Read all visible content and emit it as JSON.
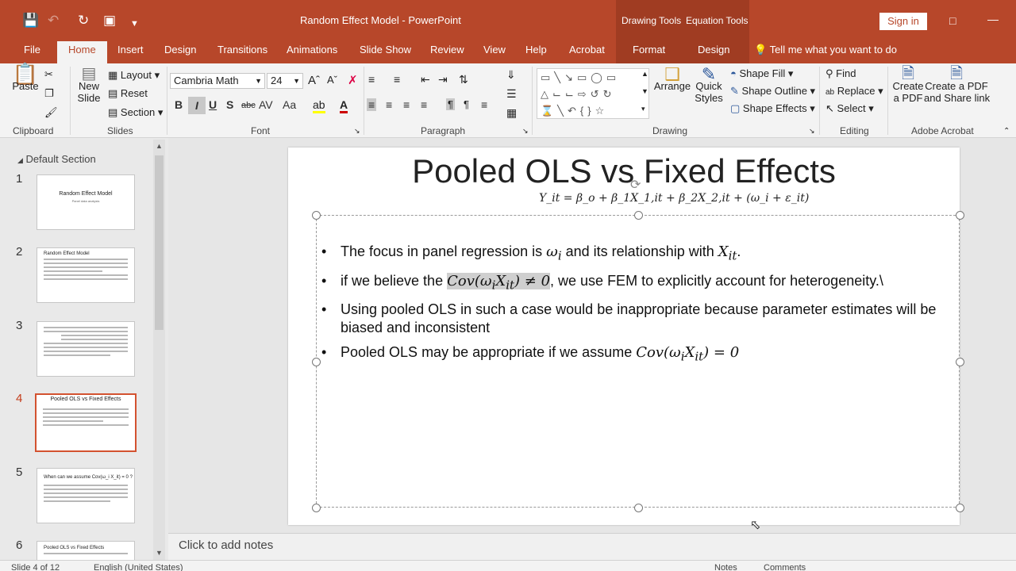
{
  "window": {
    "title": "Random Effect Model  -  PowerPoint",
    "context_tabs": [
      "Drawing Tools",
      "Equation Tools"
    ],
    "sign_in": "Sign in"
  },
  "tabs": [
    "File",
    "Home",
    "Insert",
    "Design",
    "Transitions",
    "Animations",
    "Slide Show",
    "Review",
    "View",
    "Help",
    "Acrobat",
    "Format",
    "Design"
  ],
  "tell_me": "Tell me what you want to do",
  "ribbon": {
    "clipboard": {
      "label": "Clipboard",
      "paste": "Paste"
    },
    "slides": {
      "label": "Slides",
      "new_slide_1": "New",
      "new_slide_2": "Slide",
      "layout": "Layout",
      "reset": "Reset",
      "section": "Section"
    },
    "font": {
      "label": "Font",
      "family": "Cambria Math",
      "size": "24"
    },
    "paragraph": {
      "label": "Paragraph"
    },
    "drawing": {
      "label": "Drawing",
      "arrange": "Arrange",
      "quick_styles_1": "Quick",
      "quick_styles_2": "Styles",
      "shape_fill": "Shape Fill",
      "shape_outline": "Shape Outline",
      "shape_effects": "Shape Effects"
    },
    "editing": {
      "label": "Editing",
      "find": "Find",
      "replace": "Replace",
      "select": "Select"
    },
    "acrobat": {
      "label": "Adobe Acrobat",
      "create_pdf_1": "Create",
      "create_pdf_2": "a PDF",
      "create_share_1": "Create a PDF",
      "create_share_2": "and Share link"
    }
  },
  "left_panel": {
    "section": "Default Section",
    "thumbnails": [
      {
        "num": "1",
        "title": "Random Effect Model",
        "subtitle": "Panel data analysis"
      },
      {
        "num": "2",
        "title": "Random Effect Model"
      },
      {
        "num": "3",
        "title": ""
      },
      {
        "num": "4",
        "title": "Pooled OLS vs Fixed Effects"
      },
      {
        "num": "5",
        "title": "When can we assume Cov(ω_i X_it) = 0 ?"
      },
      {
        "num": "6",
        "title": "Pooled OLS vs Fixed Effects"
      }
    ]
  },
  "slide": {
    "title": "Pooled OLS vs Fixed Effects",
    "equation": "Y_it = β_o + β_1X_1,it + β_2X_2,it + (ω_i + ε_it)",
    "bullets": [
      {
        "before": "The focus in panel regression is ",
        "math1": "ω",
        "sub1": "i",
        "mid": " and its relationship with ",
        "math2": "X",
        "sub2": "it",
        "after": "."
      },
      {
        "before": "if we believe the ",
        "math": "Cov(ω",
        "sub_a": "i",
        "math_b": "X",
        "sub_b": "it",
        "math_c": ") ≠ 0",
        "after": ", we use FEM to explicitly account for heterogeneity.\\"
      },
      {
        "text": "Using pooled OLS in such a case would be inappropriate because parameter estimates will be biased and inconsistent"
      },
      {
        "before": "Pooled OLS may be appropriate if we assume ",
        "math": "Cov(ω",
        "sub_a": "i",
        "math_b": "X",
        "sub_b": "it",
        "math_c": ") = 0"
      }
    ]
  },
  "notes": {
    "placeholder": "Click to add notes"
  },
  "status": {
    "slide": "Slide 4 of 12",
    "language": "English (United States)",
    "notes": "Notes",
    "comments": "Comments"
  }
}
